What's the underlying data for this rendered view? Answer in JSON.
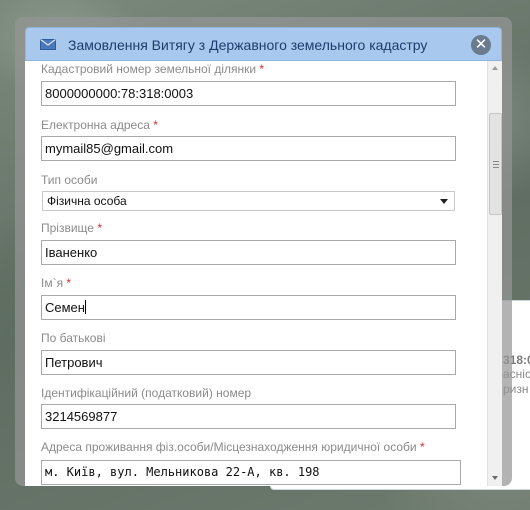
{
  "modal": {
    "title": "Замовлення Витягу з Державного земельного кадастру",
    "close_glyph": "✕"
  },
  "form": {
    "cadastral": {
      "label": "Кадастровий номер земельної ділянки",
      "required": "*",
      "value": "8000000000:78:318:0003"
    },
    "email": {
      "label": "Електронна адреса",
      "required": "*",
      "value": "mymail85@gmail.com"
    },
    "person_type": {
      "label": "Тип особи",
      "selected": "Фізична особа"
    },
    "surname": {
      "label": "Прізвище",
      "required": "*",
      "value": "Іваненко"
    },
    "name": {
      "label": "Ім`я",
      "required": "*",
      "value": "Семен"
    },
    "patronymic": {
      "label": "По батькові",
      "value": "Петрович"
    },
    "tax_id": {
      "label": "Ідентифікаційний (податковий) номер",
      "value": "3214569877"
    },
    "address": {
      "label": "Адреса проживання фіз.особи/Місцезнаходження юридичної особи",
      "required": "*",
      "value": "м. Київ, вул. Мельникова 22-А, кв. 198"
    }
  },
  "background_card": {
    "number": "318:0",
    "line1": "асніст",
    "line2": "ризн"
  },
  "icons": {
    "mail": "mail-icon",
    "close": "close-icon",
    "dropdown": "chevron-down-icon"
  },
  "colors": {
    "titlebar": "#a8c8ee",
    "title_text": "#1f3d6b",
    "required": "#d62b2b"
  }
}
